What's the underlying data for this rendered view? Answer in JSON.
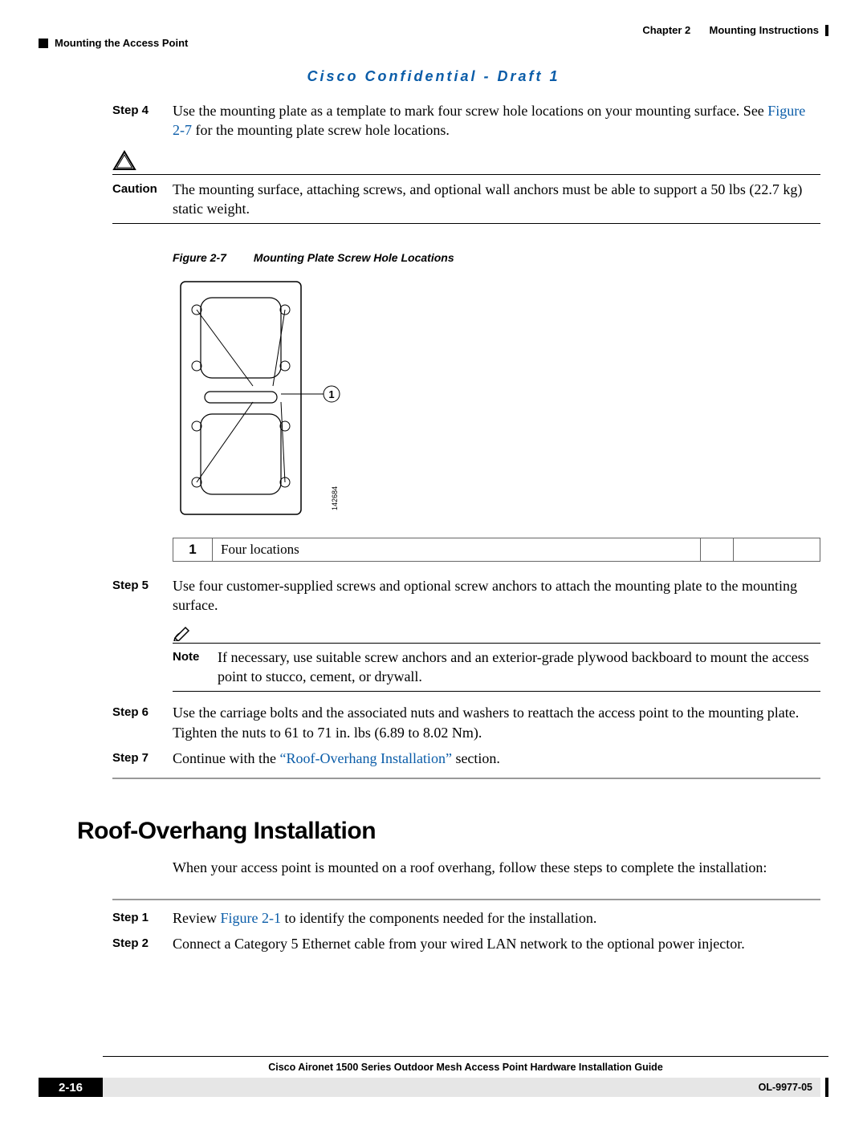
{
  "header": {
    "chapter_label": "Chapter 2",
    "chapter_title": "Mounting Instructions",
    "section_title": "Mounting the Access Point"
  },
  "confidential": "Cisco Confidential - Draft 1",
  "step4": {
    "label": "Step 4",
    "text_a": "Use the mounting plate as a template to mark four screw hole locations on your mounting surface. See ",
    "link": "Figure 2-7",
    "text_b": " for the mounting plate screw hole locations."
  },
  "caution": {
    "label": "Caution",
    "text": "The mounting surface, attaching screws, and optional wall anchors must be able to support a 50 lbs (22.7 kg) static weight."
  },
  "figure": {
    "number": "Figure 2-7",
    "title": "Mounting Plate Screw Hole Locations",
    "callout_marker": "1",
    "image_id": "142684"
  },
  "callout_table": {
    "num": "1",
    "desc": "Four locations"
  },
  "step5": {
    "label": "Step 5",
    "text": "Use four customer-supplied screws and optional screw anchors to attach the mounting plate to the mounting surface."
  },
  "note": {
    "label": "Note",
    "text": "If necessary, use suitable screw anchors and an exterior-grade plywood backboard to mount the access point to stucco, cement, or drywall."
  },
  "step6": {
    "label": "Step 6",
    "text": "Use the carriage bolts and the associated nuts and washers to reattach the access point to the mounting plate. Tighten the nuts to 61 to 71 in. lbs (6.89 to 8.02 Nm)."
  },
  "step7": {
    "label": "Step 7",
    "text_a": "Continue with the ",
    "link": "“Roof-Overhang Installation”",
    "text_b": " section."
  },
  "section_heading": "Roof-Overhang Installation",
  "intro": "When your access point is mounted on a roof overhang, follow these steps to complete the installation:",
  "r_step1": {
    "label": "Step 1",
    "text_a": "Review ",
    "link": "Figure 2-1",
    "text_b": " to identify the components needed for the installation."
  },
  "r_step2": {
    "label": "Step 2",
    "text": "Connect a Category 5 Ethernet cable from your wired LAN network to the optional power injector."
  },
  "footer": {
    "guide_title": "Cisco Aironet 1500 Series Outdoor Mesh Access Point Hardware Installation Guide",
    "page_num": "2-16",
    "doc_id": "OL-9977-05"
  }
}
